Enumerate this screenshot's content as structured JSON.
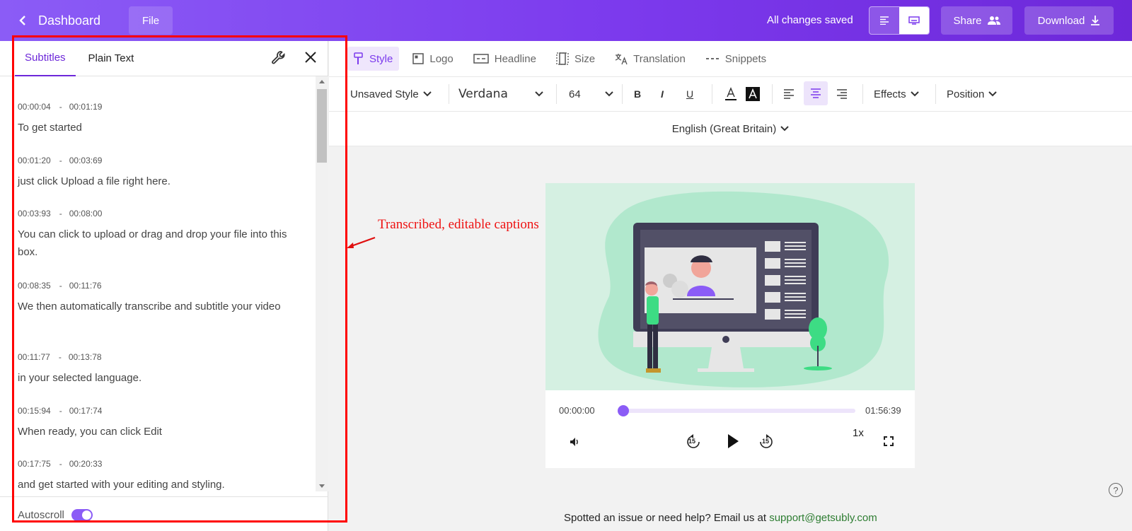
{
  "topbar": {
    "back_label": "Dashboard",
    "file_label": "File",
    "status": "All changes saved",
    "share_label": "Share",
    "download_label": "Download"
  },
  "left_panel": {
    "tabs": [
      "Subtitles",
      "Plain Text"
    ],
    "captions": [
      {
        "start": "00:00:04",
        "end": "00:01:19",
        "text": "To get started"
      },
      {
        "start": "00:01:20",
        "end": "00:03:69",
        "text": "just click Upload a file right here."
      },
      {
        "start": "00:03:93",
        "end": "00:08:00",
        "text": "You can click to upload or drag and drop your file into this box."
      },
      {
        "start": "00:08:35",
        "end": "00:11:76",
        "text": "We then automatically transcribe and subtitle your video"
      },
      {
        "start": "00:11:77",
        "end": "00:13:78",
        "text": "in your selected language."
      },
      {
        "start": "00:15:94",
        "end": "00:17:74",
        "text": "When ready, you can click Edit"
      },
      {
        "start": "00:17:75",
        "end": "00:20:33",
        "text": "and get started with your editing and styling."
      }
    ],
    "separator": "-",
    "autoscroll_label": "Autoscroll",
    "autoscroll_on": true
  },
  "annotation": {
    "text": "Transcribed, editable captions",
    "color": "#ff0000"
  },
  "tool_tabs": [
    {
      "label": "Style",
      "icon": "paint-roller-icon"
    },
    {
      "label": "Logo",
      "icon": "logo-icon"
    },
    {
      "label": "Headline",
      "icon": "headline-icon"
    },
    {
      "label": "Size",
      "icon": "size-icon"
    },
    {
      "label": "Translation",
      "icon": "translation-icon"
    },
    {
      "label": "Snippets",
      "icon": "snippets-icon"
    }
  ],
  "format": {
    "style_preset": "Unsaved Style",
    "font": "Verdana",
    "font_size": "64",
    "effects_label": "Effects",
    "position_label": "Position",
    "active_alignment": "center"
  },
  "language": "English (Great Britain)",
  "player": {
    "current_time": "00:00:00",
    "duration": "01:56:39",
    "speed": "1x",
    "skip_seconds": "15",
    "progress": 0
  },
  "footer": {
    "text": "Spotted an issue or need help? Email us at ",
    "email": "support@getsubly.com"
  },
  "colors": {
    "accent": "#7c3aed",
    "video_bg": "#d5f0e2"
  }
}
